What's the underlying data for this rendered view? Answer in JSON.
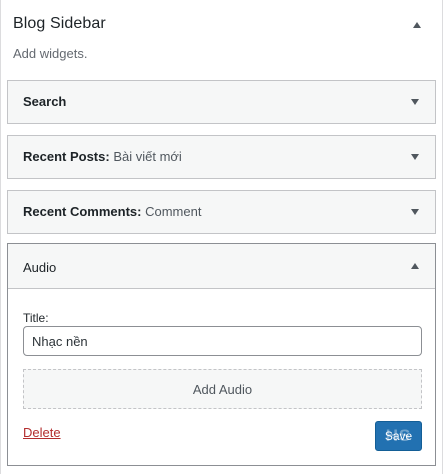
{
  "sidebar_area": {
    "title": "Blog Sidebar",
    "description": "Add widgets."
  },
  "widgets": [
    {
      "name": "Search",
      "in_title": ""
    },
    {
      "name": "Recent Posts:",
      "in_title": "Bài viết mới"
    },
    {
      "name": "Recent Comments:",
      "in_title": "Comment"
    },
    {
      "name": "Audio",
      "in_title": ""
    }
  ],
  "audio_widget": {
    "title_label": "Title:",
    "title_value": "Nhạc nền",
    "add_audio_label": "Add Audio",
    "delete_label": "Delete",
    "save_label": "Save",
    "watermark_text": "HS"
  },
  "colors": {
    "accent": "#2271b1",
    "delete": "#b32d2e",
    "border": "#c3c4c7"
  },
  "icons": {
    "collapse": "arrow-up-icon",
    "expand": "arrow-down-icon"
  }
}
